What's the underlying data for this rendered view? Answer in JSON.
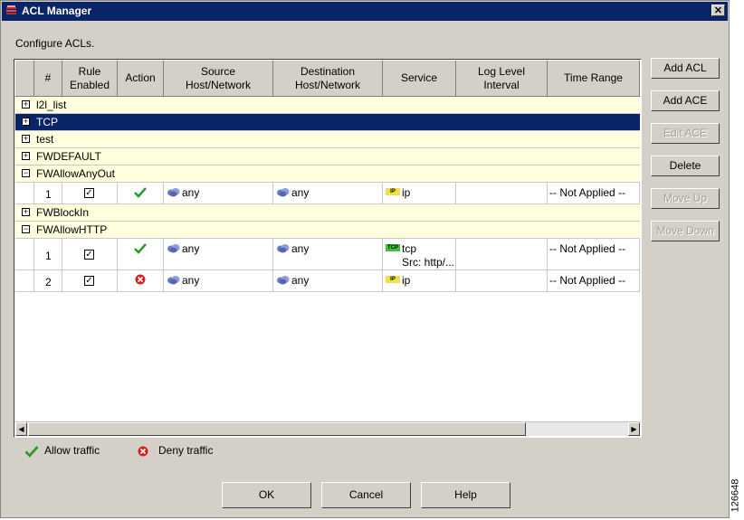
{
  "window": {
    "title": "ACL Manager"
  },
  "subtitle": "Configure ACLs.",
  "columns": [
    {
      "l1": "#",
      "l2": ""
    },
    {
      "l1": "Rule",
      "l2": "Enabled"
    },
    {
      "l1": "Action",
      "l2": ""
    },
    {
      "l1": "Source",
      "l2": "Host/Network"
    },
    {
      "l1": "Destination",
      "l2": "Host/Network"
    },
    {
      "l1": "Service",
      "l2": ""
    },
    {
      "l1": "Log Level",
      "l2": "Interval"
    },
    {
      "l1": "Time Range",
      "l2": ""
    }
  ],
  "groups": {
    "g1": "l2l_list",
    "g2": "TCP",
    "g3": "test",
    "g4": "FWDEFAULT",
    "g5": "FWAllowAnyOut",
    "g6": "FWBlockIn",
    "g7": "FWAllowHTTP"
  },
  "rows": {
    "r1": {
      "num": "1",
      "source": "any",
      "destination": "any",
      "service_badge": "IP",
      "service": "ip",
      "service2": "",
      "time_range": "-- Not Applied --",
      "action": "allow"
    },
    "r2": {
      "num": "1",
      "source": "any",
      "destination": "any",
      "service_badge": "TCP",
      "service": "tcp",
      "service2": "Src: http/...",
      "time_range": "-- Not Applied --",
      "action": "allow"
    },
    "r3": {
      "num": "2",
      "source": "any",
      "destination": "any",
      "service_badge": "IP",
      "service": "ip",
      "service2": "",
      "time_range": "-- Not Applied --",
      "action": "deny"
    }
  },
  "side_buttons": {
    "add_acl": "Add ACL",
    "add_ace": "Add ACE",
    "edit_ace": "Edit ACE",
    "delete": "Delete",
    "move_up": "Move Up",
    "move_down": "Move Down"
  },
  "legend": {
    "allow": "Allow traffic",
    "deny": "Deny traffic"
  },
  "bottom_buttons": {
    "ok": "OK",
    "cancel": "Cancel",
    "help": "Help"
  },
  "figure_number": "126648",
  "colors": {
    "title_bar": "#0a246a",
    "group_row": "#ffffdd",
    "allow": "#2a9a2a",
    "deny": "#d02020",
    "dialog": "#d4d0c8"
  }
}
